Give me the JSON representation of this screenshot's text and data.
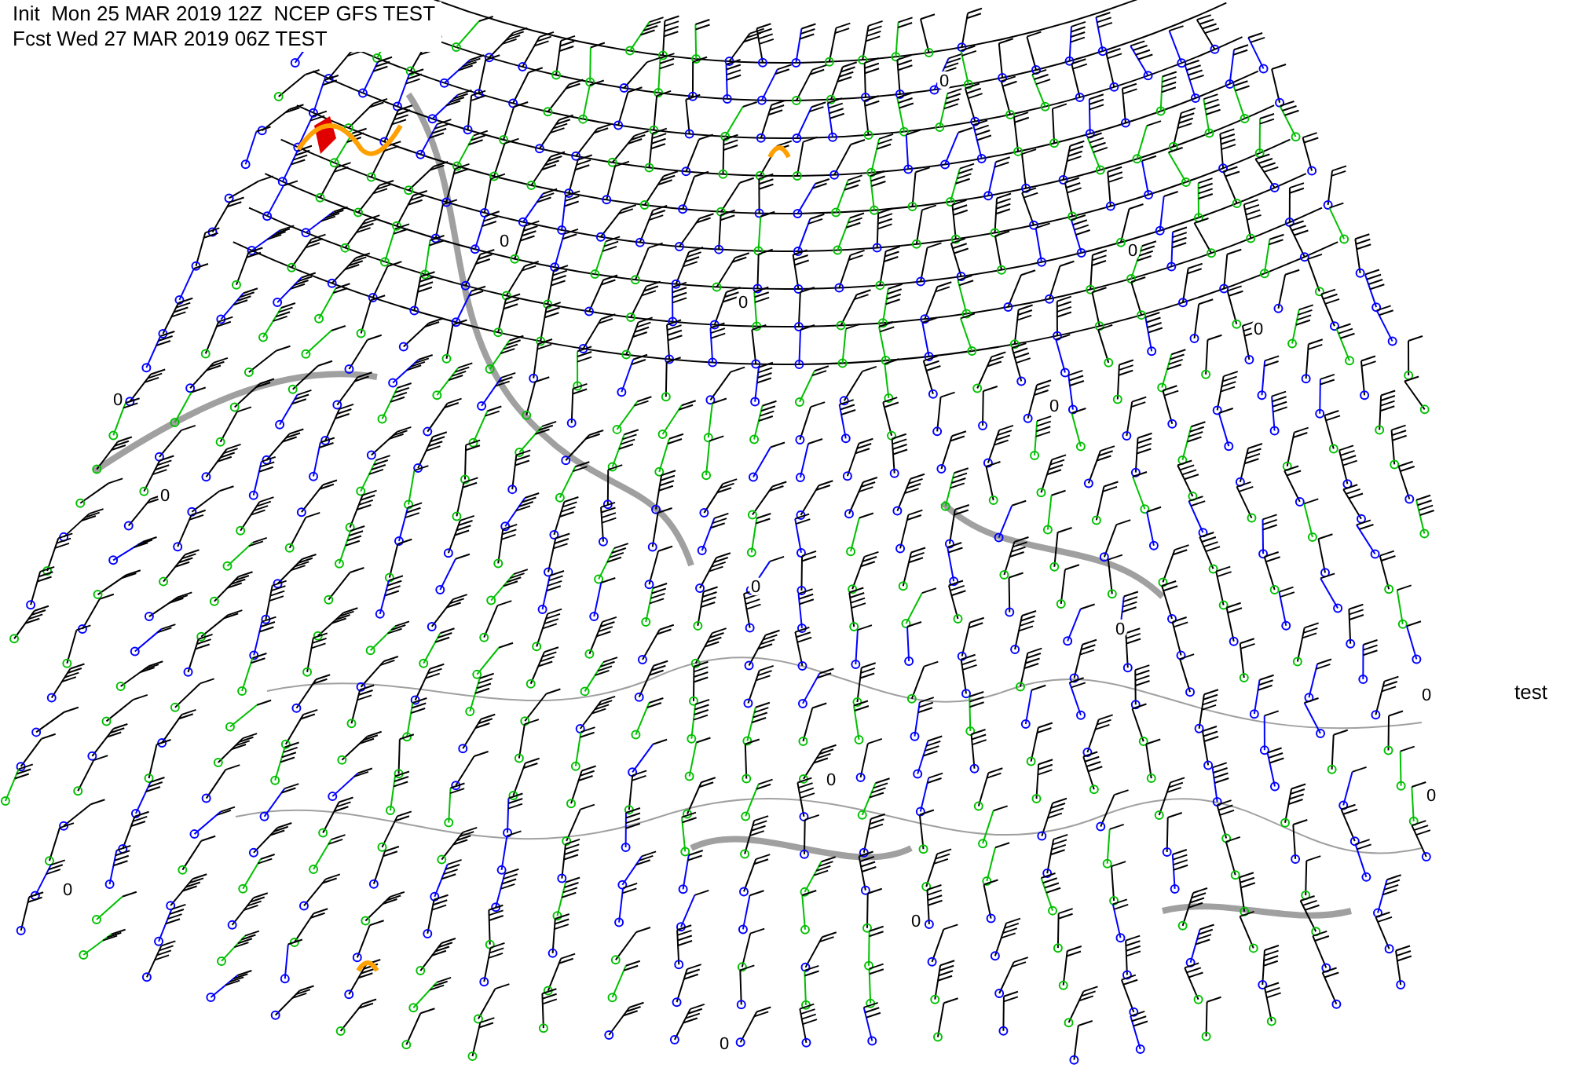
{
  "header": {
    "init_line": "Init  Mon 25 MAR 2019 12Z  NCEP GFS TEST",
    "forecast_line": "Fcst Wed 27 MAR 2019 06Z TEST"
  },
  "side_label": "test",
  "contour_labels": [
    "0",
    "0",
    "0",
    "0",
    "0",
    "0",
    "0",
    "0",
    "0",
    "0",
    "0",
    "0",
    "0",
    "0",
    "0",
    "0"
  ]
}
